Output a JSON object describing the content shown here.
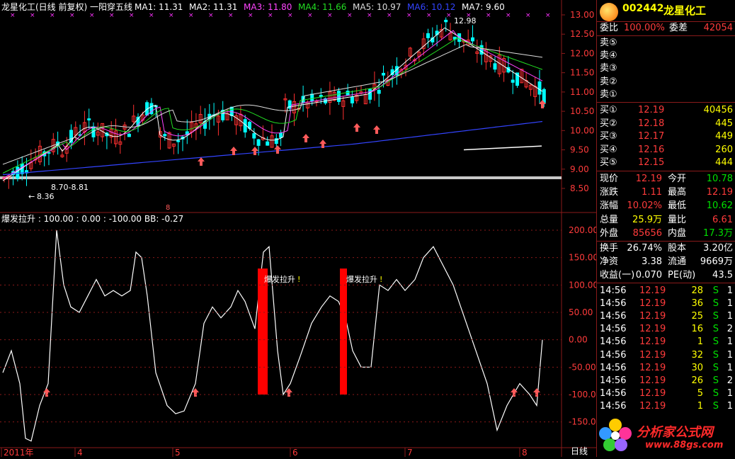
{
  "chart": {
    "header": "龙星化工(日线 前复权) 一阳穿五线",
    "ma": [
      {
        "label": "MA1: 11.31",
        "color": "#ffffff"
      },
      {
        "label": "MA2: 11.31",
        "color": "#ffffff"
      },
      {
        "label": "MA3: 11.80",
        "color": "#ff44ff"
      },
      {
        "label": "MA4: 11.66",
        "color": "#22dd22"
      },
      {
        "label": "MA5: 10.97",
        "color": "#dddddd"
      },
      {
        "label": "MA6: 10.12",
        "color": "#3344ff"
      },
      {
        "label": "MA7: 9.60",
        "color": "#ffffff"
      }
    ],
    "price_axis": [
      "13.00",
      "12.50",
      "12.00",
      "11.50",
      "11.00",
      "10.50",
      "10.00",
      "9.50",
      "9.00",
      "8.50"
    ],
    "high_label": "12.98",
    "low_label": "8.36",
    "range_label": "8.70-8.81",
    "indicator_header": "爆发拉升 : 100.00 : 0.00 : -100.00 BB: -0.27",
    "indicator_axis": [
      "200.00",
      "150.00",
      "100.00",
      "50.00",
      "0.00",
      "-50.00",
      "-100.00",
      "-150.00"
    ],
    "signal_label": "爆发拉升",
    "months": [
      "2011年",
      "4",
      "5",
      "6",
      "7",
      "8"
    ],
    "period": "日线",
    "colors": {
      "up": "#ff3030",
      "down": "#00ffff",
      "grid": "#8a1a1a",
      "axis_text": "#ff3b3b",
      "signal_bar": "#ff0000"
    }
  },
  "quote": {
    "code": "002442",
    "name": "龙星化工",
    "weibi_label": "委比",
    "weibi_value": "100.00%",
    "weicha_label": "委差",
    "weicha_value": "42054",
    "sell": [
      {
        "label": "卖⑤"
      },
      {
        "label": "卖④"
      },
      {
        "label": "卖③"
      },
      {
        "label": "卖②"
      },
      {
        "label": "卖①"
      }
    ],
    "buy": [
      {
        "label": "买①",
        "price": "12.19",
        "vol": "40456"
      },
      {
        "label": "买②",
        "price": "12.18",
        "vol": "445"
      },
      {
        "label": "买③",
        "price": "12.17",
        "vol": "449"
      },
      {
        "label": "买④",
        "price": "12.16",
        "vol": "260"
      },
      {
        "label": "买⑤",
        "price": "12.15",
        "vol": "444"
      }
    ],
    "stats": [
      {
        "l1": "现价",
        "v1": "12.19",
        "c1": "red",
        "l2": "今开",
        "v2": "10.78",
        "c2": "green"
      },
      {
        "l1": "涨跌",
        "v1": "1.11",
        "c1": "red",
        "l2": "最高",
        "v2": "12.19",
        "c2": "red"
      },
      {
        "l1": "涨幅",
        "v1": "10.02%",
        "c1": "red",
        "l2": "最低",
        "v2": "10.62",
        "c2": "green"
      },
      {
        "l1": "总量",
        "v1": "25.9万",
        "c1": "yellow",
        "l2": "量比",
        "v2": "6.61",
        "c2": "red"
      },
      {
        "l1": "外盘",
        "v1": "85656",
        "c1": "red",
        "l2": "内盘",
        "v2": "17.3万",
        "c2": "green"
      }
    ],
    "fin": [
      {
        "l1": "换手",
        "v1": "26.74%",
        "l2": "股本",
        "v2": "3.20亿"
      },
      {
        "l1": "净资",
        "v1": "3.38",
        "l2": "流通",
        "v2": "9669万"
      },
      {
        "l1": "收益(一)",
        "v1": "0.070",
        "l2": "PE(动)",
        "v2": "43.5"
      }
    ],
    "ticks": [
      {
        "time": "14:56",
        "price": "12.19",
        "vol": "28",
        "bs": "S",
        "n": "1"
      },
      {
        "time": "14:56",
        "price": "12.19",
        "vol": "36",
        "bs": "S",
        "n": "1"
      },
      {
        "time": "14:56",
        "price": "12.19",
        "vol": "25",
        "bs": "S",
        "n": "1"
      },
      {
        "time": "14:56",
        "price": "12.19",
        "vol": "16",
        "bs": "S",
        "n": "2"
      },
      {
        "time": "14:56",
        "price": "12.19",
        "vol": "1",
        "bs": "S",
        "n": "1"
      },
      {
        "time": "14:56",
        "price": "12.19",
        "vol": "32",
        "bs": "S",
        "n": "1"
      },
      {
        "time": "14:56",
        "price": "12.19",
        "vol": "30",
        "bs": "S",
        "n": "1"
      },
      {
        "time": "14:56",
        "price": "12.19",
        "vol": "26",
        "bs": "S",
        "n": "2"
      },
      {
        "time": "14:56",
        "price": "12.19",
        "vol": "5",
        "bs": "S",
        "n": "1"
      },
      {
        "time": "14:56",
        "price": "12.19",
        "vol": "1",
        "bs": "S",
        "n": "1"
      }
    ]
  },
  "watermark": {
    "name": "分析家公式网",
    "url": "www.88gs.com"
  }
}
